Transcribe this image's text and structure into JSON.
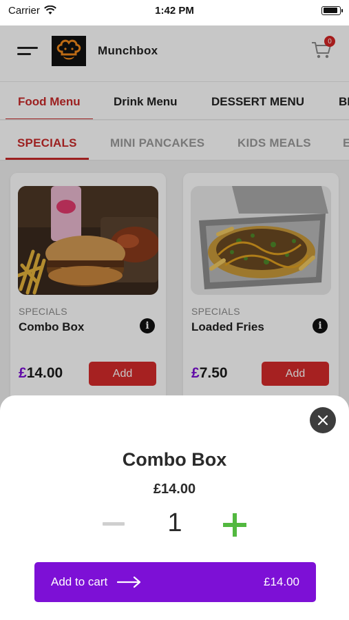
{
  "status_bar": {
    "carrier": "Carrier",
    "time": "1:42 PM",
    "battery_level": 0.9
  },
  "header": {
    "brand": "Munchbox",
    "cart_count": "0"
  },
  "menu_tabs": [
    {
      "label": "Food Menu",
      "active": true
    },
    {
      "label": "Drink Menu",
      "active": false
    },
    {
      "label": "DESSERT MENU",
      "active": false
    },
    {
      "label": "BE",
      "active": false
    }
  ],
  "category_tabs": [
    {
      "label": "SPECIALS",
      "active": true
    },
    {
      "label": "MINI PANCAKES",
      "active": false
    },
    {
      "label": "KIDS MEALS",
      "active": false
    },
    {
      "label": "E",
      "active": false
    }
  ],
  "products": [
    {
      "category": "SPECIALS",
      "name": "Combo Box",
      "currency": "£",
      "price": "14.00",
      "add_label": "Add"
    },
    {
      "category": "SPECIALS",
      "name": "Loaded Fries",
      "currency": "£",
      "price": "7.50",
      "add_label": "Add"
    }
  ],
  "sheet": {
    "title": "Combo Box",
    "price": "£14.00",
    "quantity": "1",
    "add_to_cart_label": "Add to cart",
    "total": "£14.00"
  },
  "colors": {
    "accent_red": "#c82a2a",
    "add_button_red": "#d52b2b",
    "purple": "#7d10d6",
    "plus_green": "#52b83f"
  }
}
